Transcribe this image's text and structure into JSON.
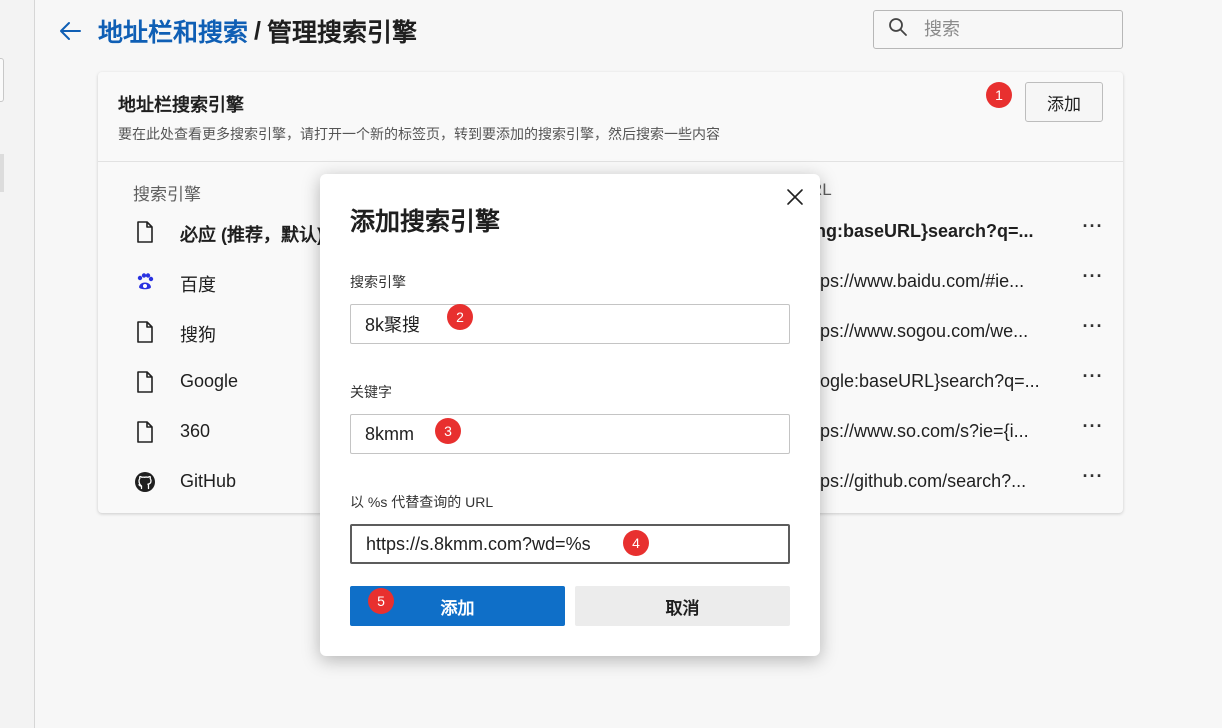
{
  "header": {
    "breadcrumb_link": "地址栏和搜索",
    "separator": "/",
    "current": "管理搜索引擎",
    "search_placeholder": "搜索"
  },
  "card": {
    "title": "地址栏搜索引擎",
    "description": "要在此处查看更多搜索引擎，请打开一个新的标签页，转到要添加的搜索引擎，然后搜索一些内容",
    "add_label": "添加",
    "columns": [
      "搜索引擎",
      "RL"
    ],
    "rows": [
      {
        "name": "必应 (推荐，默认)",
        "url": "ing:baseURL}search?q=...",
        "icon": "page-icon",
        "bold": true
      },
      {
        "name": "百度",
        "url": "ttps://www.baidu.com/#ie...",
        "icon": "baidu-paw-icon"
      },
      {
        "name": "搜狗",
        "url": "ttps://www.sogou.com/we...",
        "icon": "page-icon"
      },
      {
        "name": "Google",
        "url": "oogle:baseURL}search?q=...",
        "icon": "page-icon"
      },
      {
        "name": "360",
        "url": "ttps://www.so.com/s?ie={i...",
        "icon": "page-icon"
      },
      {
        "name": "GitHub",
        "url": "ttps://github.com/search?...",
        "icon": "github-icon"
      }
    ],
    "more_label": "···"
  },
  "dialog": {
    "title": "添加搜索引擎",
    "engine_label": "搜索引擎",
    "engine_value": "8k聚搜",
    "keyword_label": "关键字",
    "keyword_value": "8kmm",
    "url_label": "以 %s 代替查询的 URL",
    "url_value": "https://s.8kmm.com?wd=%s",
    "add_label": "添加",
    "cancel_label": "取消"
  },
  "badges": [
    "1",
    "2",
    "3",
    "4",
    "5"
  ],
  "colors": {
    "accent": "#0f6fc8",
    "link": "#0f5fb5",
    "badge": "#e8302f",
    "baidu": "#2932e1"
  }
}
